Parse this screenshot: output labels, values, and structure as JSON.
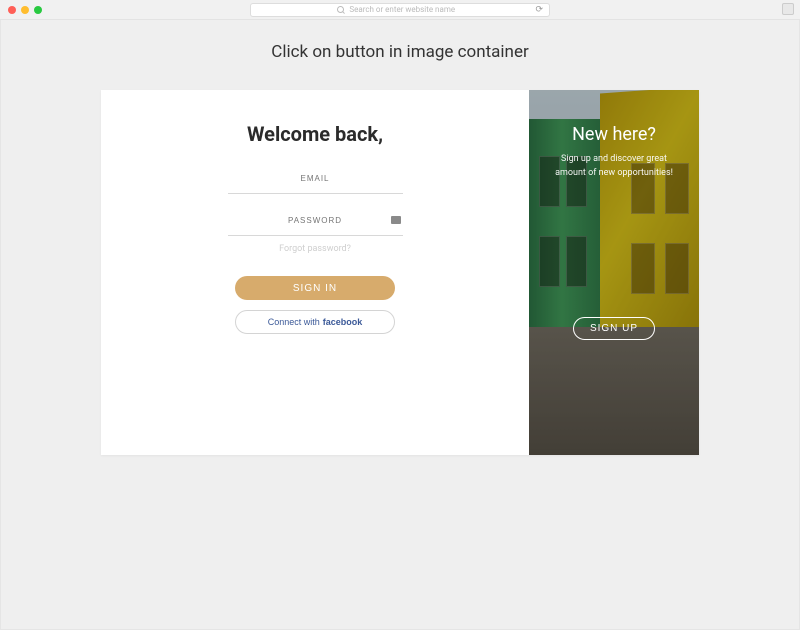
{
  "browser": {
    "placeholder": "Search or enter website name"
  },
  "instruction": "Click on button in image container",
  "login": {
    "title": "Welcome back,",
    "email_placeholder": "EMAIL",
    "password_placeholder": "PASSWORD",
    "forgot": "Forgot password?",
    "signin_label": "SIGN IN",
    "connect_prefix": "Connect with",
    "connect_brand": "facebook"
  },
  "signup": {
    "title": "New here?",
    "subtitle_line1": "Sign up and discover great",
    "subtitle_line2": "amount of new opportunities!",
    "button_label": "SIGN UP"
  }
}
